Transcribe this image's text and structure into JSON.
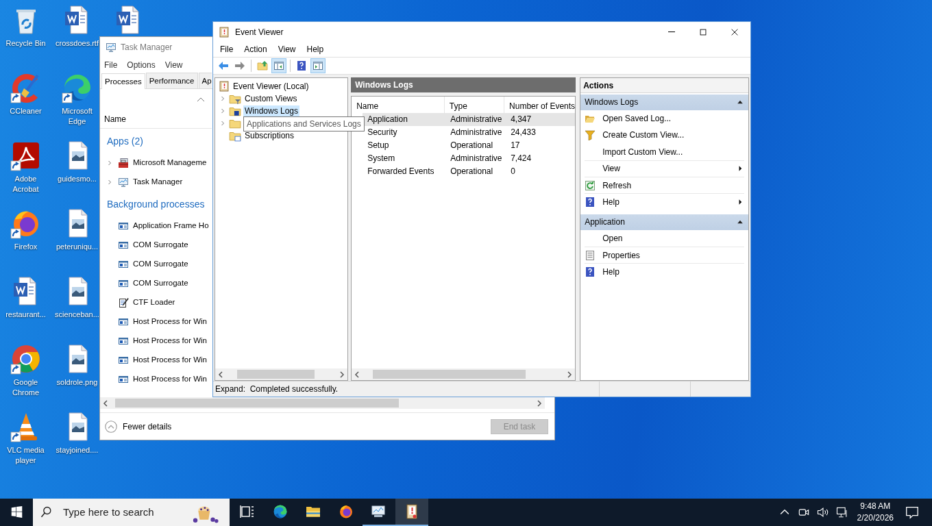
{
  "desktop": {
    "icons": [
      {
        "label": "Recycle Bin",
        "kind": "recycle",
        "shortcut": false
      },
      {
        "label": "CCleaner",
        "kind": "ccleaner",
        "shortcut": true
      },
      {
        "label": "Adobe Acrobat",
        "kind": "acrobat",
        "shortcut": true
      },
      {
        "label": "Firefox",
        "kind": "firefox",
        "shortcut": true
      },
      {
        "label": "restaurant...",
        "kind": "word",
        "shortcut": false
      },
      {
        "label": "Google Chrome",
        "kind": "chrome",
        "shortcut": true
      },
      {
        "label": "VLC media player",
        "kind": "vlc",
        "shortcut": true
      },
      {
        "label": "crossdoes.rtf",
        "kind": "word",
        "shortcut": false
      },
      {
        "label": "Microsoft Edge",
        "kind": "edge",
        "shortcut": true
      },
      {
        "label": "guidesmo...",
        "kind": "image",
        "shortcut": false
      },
      {
        "label": "peteruniqu...",
        "kind": "image",
        "shortcut": false
      },
      {
        "label": "scienceban...",
        "kind": "image",
        "shortcut": false
      },
      {
        "label": "soldrole.png",
        "kind": "image",
        "shortcut": false
      },
      {
        "label": "stayjoined....",
        "kind": "image",
        "shortcut": false
      },
      {
        "kind": "word",
        "shortcut": false
      }
    ]
  },
  "task_manager": {
    "title": "Task Manager",
    "menu": [
      "File",
      "Options",
      "View"
    ],
    "tabs": [
      {
        "label": "Processes",
        "selected": true
      },
      {
        "label": "Performance",
        "selected": false
      },
      {
        "label": "Ap",
        "selected": false
      }
    ],
    "name_column": "Name",
    "groups": [
      {
        "title": "Apps (2)",
        "processes": [
          {
            "name": "Microsoft Manageme",
            "kind": "mmc",
            "expandable": true
          },
          {
            "name": "Task Manager",
            "kind": "taskmgr",
            "expandable": true
          }
        ]
      },
      {
        "title": "Background processes",
        "processes": [
          {
            "name": "Application Frame Ho",
            "kind": "window",
            "expandable": false
          },
          {
            "name": "COM Surrogate",
            "kind": "window",
            "expandable": false
          },
          {
            "name": "COM Surrogate",
            "kind": "window",
            "expandable": false
          },
          {
            "name": "COM Surrogate",
            "kind": "window",
            "expandable": false
          },
          {
            "name": "CTF Loader",
            "kind": "ctf",
            "expandable": false
          },
          {
            "name": "Host Process for Win",
            "kind": "window",
            "expandable": false
          },
          {
            "name": "Host Process for Win",
            "kind": "window",
            "expandable": false
          },
          {
            "name": "Host Process for Win",
            "kind": "window",
            "expandable": false
          },
          {
            "name": "Host Process for Win",
            "kind": "window",
            "expandable": false
          }
        ]
      }
    ],
    "details_toggle": "Fewer details",
    "end_task": {
      "label": "End task",
      "disabled": true
    }
  },
  "event_viewer": {
    "title": "Event Viewer",
    "menu": [
      "File",
      "Action",
      "View",
      "Help"
    ],
    "toolbar": [
      [
        {
          "kind": "back",
          "pressed": false
        },
        {
          "kind": "forward",
          "pressed": false
        }
      ],
      [
        {
          "kind": "up",
          "pressed": false
        },
        {
          "kind": "tree",
          "pressed": true
        }
      ],
      [
        {
          "kind": "help",
          "pressed": false
        },
        {
          "kind": "actionpane",
          "pressed": true
        }
      ]
    ],
    "tree": {
      "label": "Event Viewer (Local)",
      "children": [
        {
          "label": "Custom Views",
          "kind": "filter",
          "expandable": true,
          "selected": false,
          "tooltip": false
        },
        {
          "label": "Windows Logs",
          "kind": "logs",
          "expandable": true,
          "selected": true,
          "tooltip": false
        },
        {
          "label": "Applications and Services Logs",
          "kind": "folder",
          "expandable": true,
          "selected": false,
          "tooltip": true
        },
        {
          "label": "Subscriptions",
          "kind": "subscriptions",
          "expandable": false,
          "selected": false,
          "tooltip": false
        }
      ]
    },
    "log_pane": {
      "title": "Windows Logs",
      "columns": [
        "Name",
        "Type",
        "Number of Events"
      ],
      "rows": [
        {
          "name": "Application",
          "type": "Administrative",
          "count": "4,347",
          "selected": true
        },
        {
          "name": "Security",
          "type": "Administrative",
          "count": "24,433",
          "selected": false
        },
        {
          "name": "Setup",
          "type": "Operational",
          "count": "17",
          "selected": false
        },
        {
          "name": "System",
          "type": "Administrative",
          "count": "7,424",
          "selected": false
        },
        {
          "name": "Forwarded Events",
          "type": "Operational",
          "count": "0",
          "selected": false
        }
      ]
    },
    "actions": {
      "title": "Actions",
      "sections": [
        {
          "title": "Windows Logs",
          "expanded": true,
          "items": [
            {
              "label": "Open Saved Log...",
              "kind": "open",
              "submenu": false,
              "separator_above": false
            },
            {
              "label": "Create Custom View...",
              "kind": "filter",
              "submenu": false,
              "separator_above": false
            },
            {
              "label": "Import Custom View...",
              "submenu": false,
              "separator_above": false
            },
            {
              "label": "View",
              "submenu": true,
              "separator_above": true
            },
            {
              "label": "Refresh",
              "kind": "refresh",
              "submenu": false,
              "separator_above": true
            },
            {
              "label": "Help",
              "kind": "help",
              "submenu": true,
              "separator_above": true
            }
          ]
        },
        {
          "title": "Application",
          "expanded": true,
          "items": [
            {
              "label": "Open",
              "submenu": false,
              "separator_above": false
            },
            {
              "label": "Properties",
              "kind": "properties",
              "submenu": false,
              "separator_above": true
            },
            {
              "label": "Help",
              "kind": "help",
              "submenu": false,
              "separator_above": true
            }
          ]
        }
      ]
    },
    "status_bar": [
      "Expand:  Completed successfully."
    ]
  },
  "taskbar": {
    "search": {
      "placeholder": "Type here to search"
    },
    "apps": [
      {
        "kind": "taskview",
        "running": false,
        "selected": false
      },
      {
        "kind": "edge",
        "running": false,
        "selected": false
      },
      {
        "kind": "explorer",
        "running": false,
        "selected": false
      },
      {
        "kind": "firefox",
        "running": false,
        "selected": false
      },
      {
        "kind": "taskmgr",
        "running": true,
        "selected": false
      },
      {
        "kind": "eventviewer",
        "running": true,
        "selected": true
      }
    ],
    "clock": {
      "time": "9:48 AM",
      "date": "2/20/2026"
    }
  }
}
